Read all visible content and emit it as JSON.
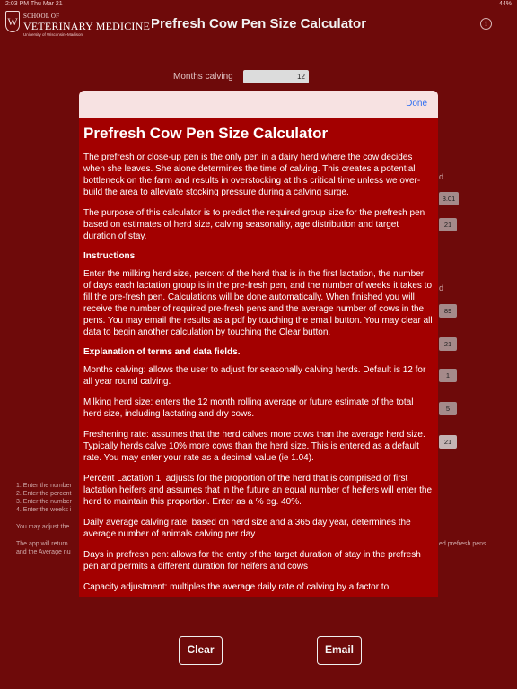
{
  "status_bar": {
    "time": "2:03 PM   Thu Mar 21",
    "right": "44%"
  },
  "logo": {
    "mark": "W",
    "line1": "SCHOOL OF",
    "line2": "VETERINARY MEDICINE",
    "line3": "University of Wisconsin–Madison"
  },
  "header": {
    "title": "Prefresh Cow Pen Size Calculator",
    "info_glyph": "i"
  },
  "form": {
    "months_calving_label": "Months calving",
    "months_calving_value": "12",
    "result_values": [
      "3.01",
      "21",
      "89",
      "21",
      "1",
      "5",
      "21"
    ],
    "letter_top": "d",
    "letter_mid": "d",
    "notes": [
      "1. Enter the number",
      "2. Enter the percent",
      "3. Enter the number",
      "4. Enter the weeks i"
    ],
    "note_adjust": "You may adjust the",
    "note_return": "The app will return",
    "note_average": "and the Average nu",
    "note_right": "ed prefresh pens"
  },
  "buttons": {
    "clear": "Clear",
    "email": "Email"
  },
  "modal": {
    "done_label": "Done",
    "title": "Prefresh Cow Pen Size Calculator",
    "intro1": "The prefresh or close-up pen is the only pen in a dairy herd where the cow decides when she leaves. She alone determines the time of calving. This creates a potential bottleneck on the farm and results in overstocking at this critical time unless we over-build the area to alleviate stocking pressure during a calving surge.",
    "intro2": "The purpose of this calculator is to predict the required group size for the prefresh pen based on estimates of herd size, calving seasonality, age distribution and target duration of stay.",
    "instructions_heading": "Instructions",
    "instructions": "Enter the milking herd size, percent of the herd that is in the first lactation, the number of days each lactation group is in the pre-fresh pen, and the number of weeks it takes to fill the pre-fresh pen. Calculations will be done automatically. When finished you will receive the number of required pre-fresh pens and the average number of cows in the pens. You may email the results as a pdf by touching the email button. You may clear all data to begin another calculation by touching the Clear button.",
    "terms_heading": "Explanation of terms and data fields.",
    "term_months": "Months calving: allows the user to adjust for seasonally calving herds. Default is 12 for all year round calving.",
    "term_herd": "Milking herd size: enters the 12 month rolling average or future estimate of the total herd size, including lactating and dry cows.",
    "term_freshening": "Freshening rate: assumes that the herd calves more cows than the average herd size. Typically herds calve 10% more cows than the herd size. This is entered as a default rate. You may enter your rate as a decimal value (ie 1.04).",
    "term_lactation": "Percent Lactation 1: adjusts for the proportion of the herd that is comprised of first lactation heifers and assumes that in the future an equal number of heifers will enter the herd to maintain this proportion. Enter as a % eg. 40%.",
    "term_daily": "Daily average calving rate: based on herd size and a 365 day year, determines the average number of animals calving per day",
    "term_days": "Days in prefresh pen: allows for the entry of the target duration of stay in the prefresh pen and permits a different duration for heifers and cows",
    "term_capacity": "Capacity adjustment: multiples the average daily rate of calving by a factor to"
  }
}
